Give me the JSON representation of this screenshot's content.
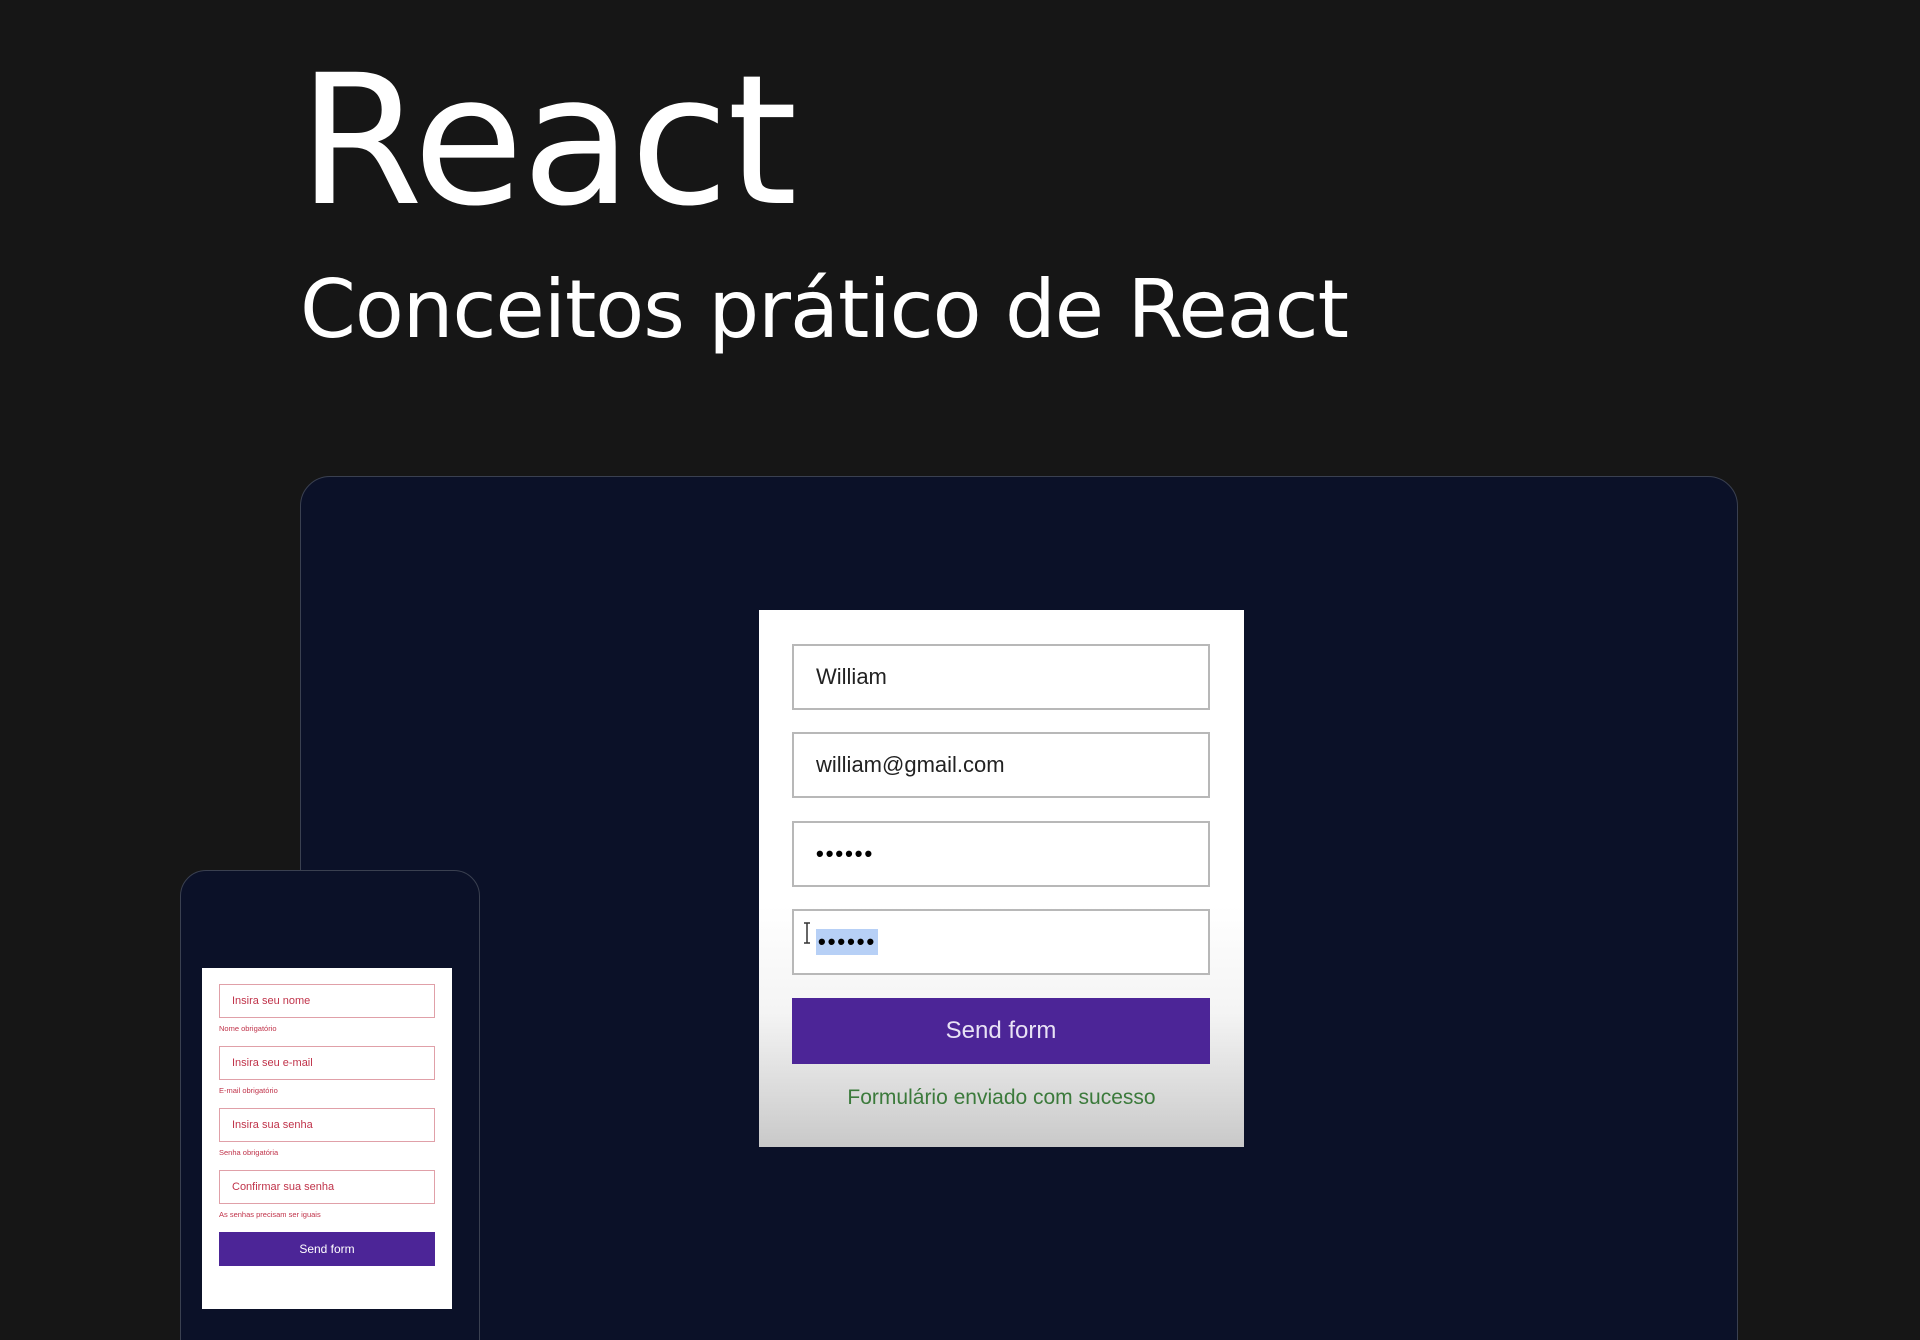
{
  "header": {
    "title": "React",
    "subtitle": "Conceitos prático de React"
  },
  "desktop_form": {
    "name_value": "William",
    "email_value": "william@gmail.com",
    "password_value": "••••••",
    "confirm_password_value": "••••••",
    "submit_label": "Send form",
    "success_message": "Formulário enviado com sucesso"
  },
  "mobile_form": {
    "fields": [
      {
        "placeholder": "Insira seu nome",
        "error": "Nome obrigatório"
      },
      {
        "placeholder": "Insira seu e-mail",
        "error": "E-mail obrigatório"
      },
      {
        "placeholder": "Insira sua senha",
        "error": "Senha obrigatória"
      },
      {
        "placeholder": "Confirmar sua senha",
        "error": "As senhas precisam ser iguais"
      }
    ],
    "submit_label": "Send form"
  },
  "colors": {
    "page_background": "#161616",
    "frame_background": "#0b1128",
    "button_purple": "#4c2597",
    "success_green": "#3b7a3b",
    "error_red": "#c0334a",
    "selection_blue": "#b7d0f6"
  },
  "icons": {
    "text_cursor": "text-cursor-icon"
  }
}
